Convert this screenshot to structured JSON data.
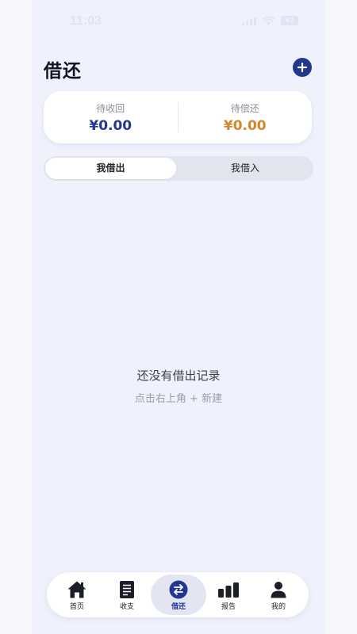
{
  "status_bar": {
    "time": "11:03",
    "battery": "82"
  },
  "header": {
    "title": "借还"
  },
  "summary": {
    "receivable_label": "待收回",
    "receivable_value": "¥0.00",
    "receivable_color": "#24378f",
    "payable_label": "待偿还",
    "payable_value": "¥0.00",
    "payable_color": "#d3862c"
  },
  "segments": {
    "lent_label": "我借出",
    "borrowed_label": "我借入",
    "selected": "我借出"
  },
  "empty_state": {
    "title": "还没有借出记录",
    "hint": "点击右上角 + 新建"
  },
  "tab_bar": {
    "items": [
      {
        "label": "首页",
        "icon": "home-icon"
      },
      {
        "label": "收支",
        "icon": "ledger-icon"
      },
      {
        "label": "借还",
        "icon": "swap-icon",
        "active": true
      },
      {
        "label": "报告",
        "icon": "bar-chart-icon"
      },
      {
        "label": "我的",
        "icon": "person-icon"
      }
    ]
  },
  "colors": {
    "accent": "#23378f",
    "background": "#eff2fd"
  }
}
